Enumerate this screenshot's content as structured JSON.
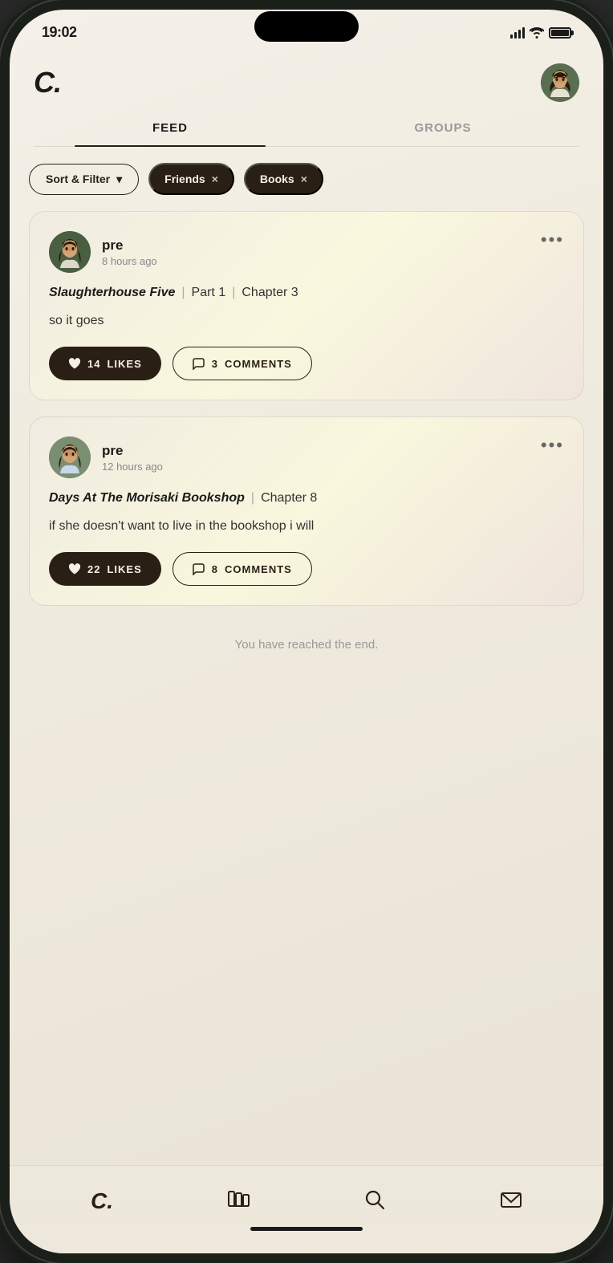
{
  "status_bar": {
    "time": "19:02",
    "signal_label": "signal",
    "wifi_label": "wifi",
    "battery_label": "battery"
  },
  "header": {
    "logo": "C.",
    "user_avatar_alt": "user avatar"
  },
  "tabs": [
    {
      "id": "feed",
      "label": "FEED",
      "active": true
    },
    {
      "id": "groups",
      "label": "GROUPS",
      "active": false
    }
  ],
  "filter_bar": {
    "sort_filter_label": "Sort & Filter",
    "chevron": "▾",
    "tags": [
      {
        "id": "friends",
        "label": "Friends",
        "x": "×"
      },
      {
        "id": "books",
        "label": "Books",
        "x": "×"
      }
    ]
  },
  "posts": [
    {
      "id": "post1",
      "username": "pre",
      "time_ago": "8 hours ago",
      "book_title": "Slaughterhouse Five",
      "part": "Part 1",
      "chapter": "Chapter 3",
      "content": "so it goes",
      "likes_count": "14",
      "likes_label": "LIKES",
      "comments_count": "3",
      "comments_label": "COMMENTS",
      "more_dots": "•••"
    },
    {
      "id": "post2",
      "username": "pre",
      "time_ago": "12 hours ago",
      "book_title": "Days At The Morisaki Bookshop",
      "part": null,
      "chapter": "Chapter 8",
      "content": "if she doesn't want to live in the bookshop i will",
      "likes_count": "22",
      "likes_label": "LIKES",
      "comments_count": "8",
      "comments_label": "COMMENTS",
      "more_dots": "•••"
    }
  ],
  "end_message": "You have reached the end.",
  "bottom_nav": {
    "items": [
      {
        "id": "home",
        "icon_type": "logo",
        "label": "C."
      },
      {
        "id": "library",
        "icon_type": "books",
        "label": "library"
      },
      {
        "id": "search",
        "icon_type": "search",
        "label": "search"
      },
      {
        "id": "messages",
        "icon_type": "mail",
        "label": "messages"
      }
    ]
  }
}
